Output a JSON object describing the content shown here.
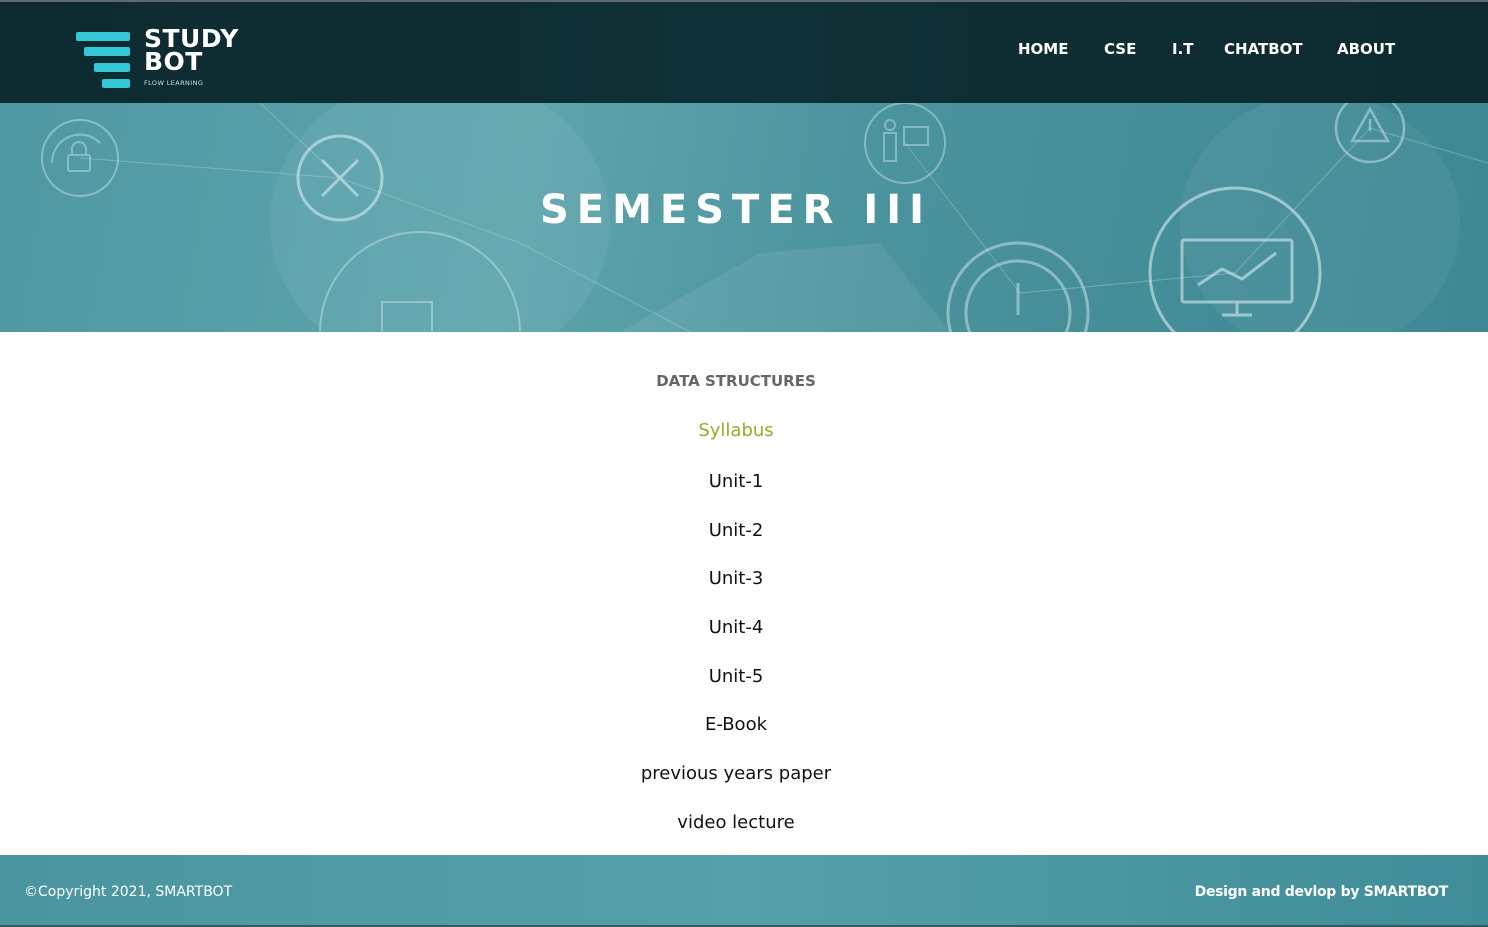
{
  "header": {
    "logo": {
      "line1": "STUDY",
      "line2": "BOT",
      "tagline": "FLOW LEARNING"
    },
    "nav": [
      "HOME",
      "CSE",
      "I.T",
      "CHATBOT",
      "ABOUT"
    ]
  },
  "hero": {
    "title": "SEMESTER III"
  },
  "main": {
    "subject": "DATA STRUCTURES",
    "syllabus": "Syllabus",
    "links": [
      "Unit-1",
      "Unit-2",
      "Unit-3",
      "Unit-4",
      "Unit-5",
      "E-Book",
      "previous years paper",
      "video lecture"
    ]
  },
  "footer": {
    "copyright": "©Copyright 2021, SMARTBOT",
    "credit": "Design and devlop by SMARTBOT"
  },
  "colors": {
    "header_bg": "#0f3036",
    "hero_bg": "#5ea5ad",
    "accent_logo": "#35c8d6",
    "syllabus": "#8fb125",
    "footer_bg": "#4a95a0"
  }
}
